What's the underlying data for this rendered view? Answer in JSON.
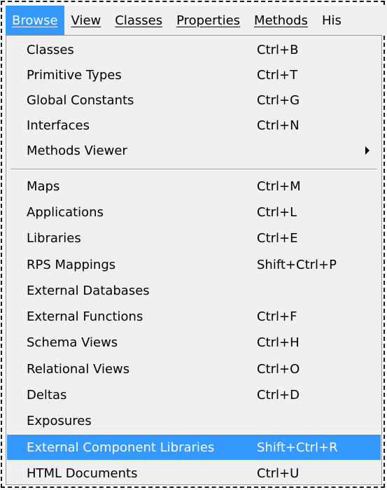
{
  "menubar": {
    "items": [
      {
        "label": "Browse"
      },
      {
        "label": "View"
      },
      {
        "label": "Classes"
      },
      {
        "label": "Properties"
      },
      {
        "label": "Methods"
      },
      {
        "label": "His"
      }
    ]
  },
  "menu": {
    "group1": [
      {
        "label": "Classes",
        "shortcut": "Ctrl+B"
      },
      {
        "label": "Primitive Types",
        "shortcut": "Ctrl+T"
      },
      {
        "label": "Global Constants",
        "shortcut": "Ctrl+G"
      },
      {
        "label": "Interfaces",
        "shortcut": "Ctrl+N"
      },
      {
        "label": "Methods Viewer",
        "shortcut": "",
        "submenu": true
      }
    ],
    "group2": [
      {
        "label": "Maps",
        "shortcut": "Ctrl+M"
      },
      {
        "label": "Applications",
        "shortcut": "Ctrl+L"
      },
      {
        "label": "Libraries",
        "shortcut": "Ctrl+E"
      },
      {
        "label": "RPS Mappings",
        "shortcut": "Shift+Ctrl+P"
      },
      {
        "label": "External Databases",
        "shortcut": ""
      },
      {
        "label": "External Functions",
        "shortcut": "Ctrl+F"
      },
      {
        "label": "Schema Views",
        "shortcut": "Ctrl+H"
      },
      {
        "label": "Relational Views",
        "shortcut": "Ctrl+O"
      },
      {
        "label": "Deltas",
        "shortcut": "Ctrl+D"
      },
      {
        "label": "Exposures",
        "shortcut": ""
      },
      {
        "label": "External Component Libraries",
        "shortcut": "Shift+Ctrl+R",
        "highlighted": true
      },
      {
        "label": "HTML Documents",
        "shortcut": "Ctrl+U"
      }
    ]
  },
  "colors": {
    "highlight": "#3399ff",
    "menu_background": "#f0f0f0"
  }
}
